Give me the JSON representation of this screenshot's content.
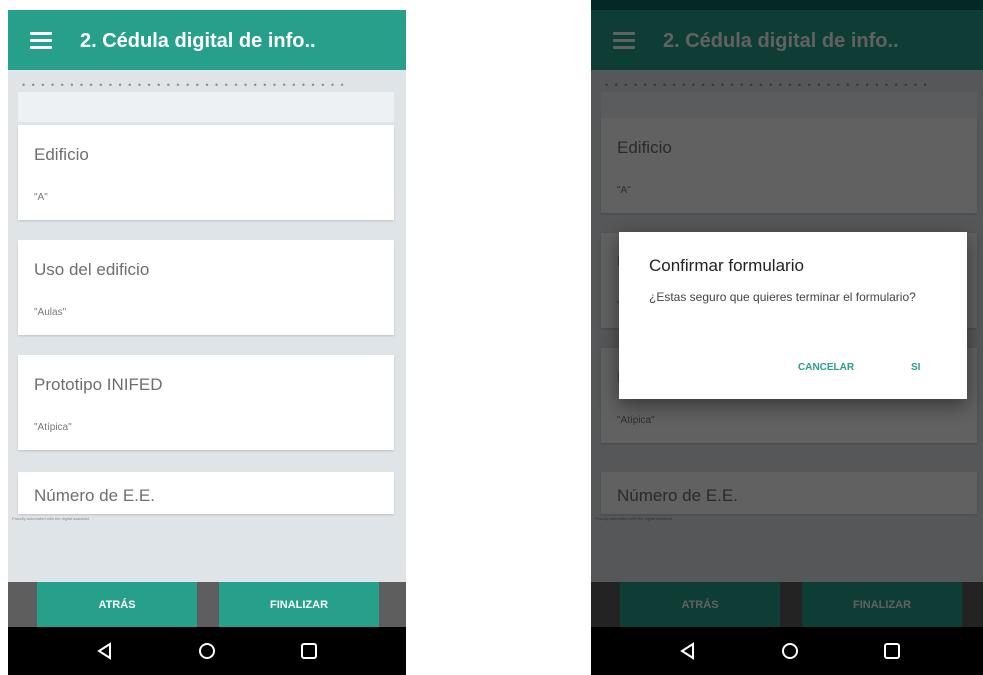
{
  "app_title": "2. Cédula digital de info..",
  "separator_dots": "• • • • • • • • • • • • • • • • • • • • • • • • • • • • • • • • • •",
  "fields": [
    {
      "label": "Edificio",
      "value": "\"A\""
    },
    {
      "label": "Uso del edificio",
      "value": "\"Aulas\""
    },
    {
      "label": "Prototipo INIFED",
      "value": "\"Atípica\""
    },
    {
      "label": "Número de E.E.",
      "value": ""
    }
  ],
  "watermark": "Proudly automated with the digital assistant",
  "nav": {
    "back_label": "ATRÁS",
    "finish_label": "FINALIZAR"
  },
  "system_icons": [
    "back-triangle-icon",
    "home-circle-icon",
    "recents-square-icon"
  ],
  "dialog": {
    "title": "Confirmar formulario",
    "message": "¿Estas seguro que quieres terminar el formulario?",
    "cancel_label": "CANCELAR",
    "confirm_label": "SI"
  },
  "colors": {
    "primary": "#26a08b",
    "primary_dark": "#0c6b5e",
    "background": "#dfe4e8",
    "nav_background": "#5e5e5e"
  }
}
